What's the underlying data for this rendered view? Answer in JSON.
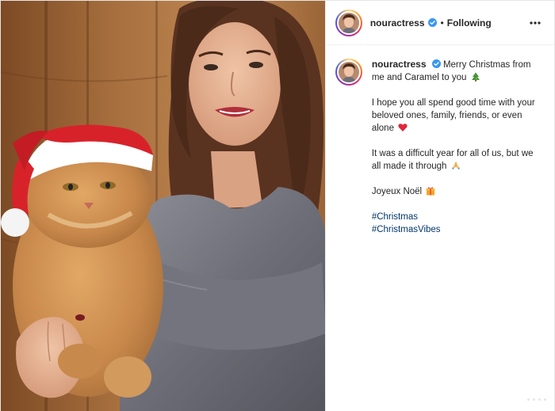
{
  "header": {
    "username": "nouractress",
    "separator": "•",
    "follow_status": "Following",
    "more_icon": "more-horizontal-icon"
  },
  "caption": {
    "username": "nouractress",
    "line1": "Merry Christmas from me and Caramel to you",
    "line1_emoji": "christmas-tree-icon",
    "para2": "I hope you all spend good time with your beloved ones, family, friends, or even alone",
    "para2_emoji": "red-heart-icon",
    "para3": "It was a difficult year for all of us, but we all made it through",
    "para3_emoji": "folded-hands-icon",
    "para4": "Joyeux Noël",
    "para4_emoji": "gift-icon",
    "hashtags": [
      "#Christmas",
      "#ChristmasVibes"
    ]
  },
  "colors": {
    "verified_badge": "#3897f0",
    "hashtag": "#00376b",
    "text": "#262626"
  }
}
